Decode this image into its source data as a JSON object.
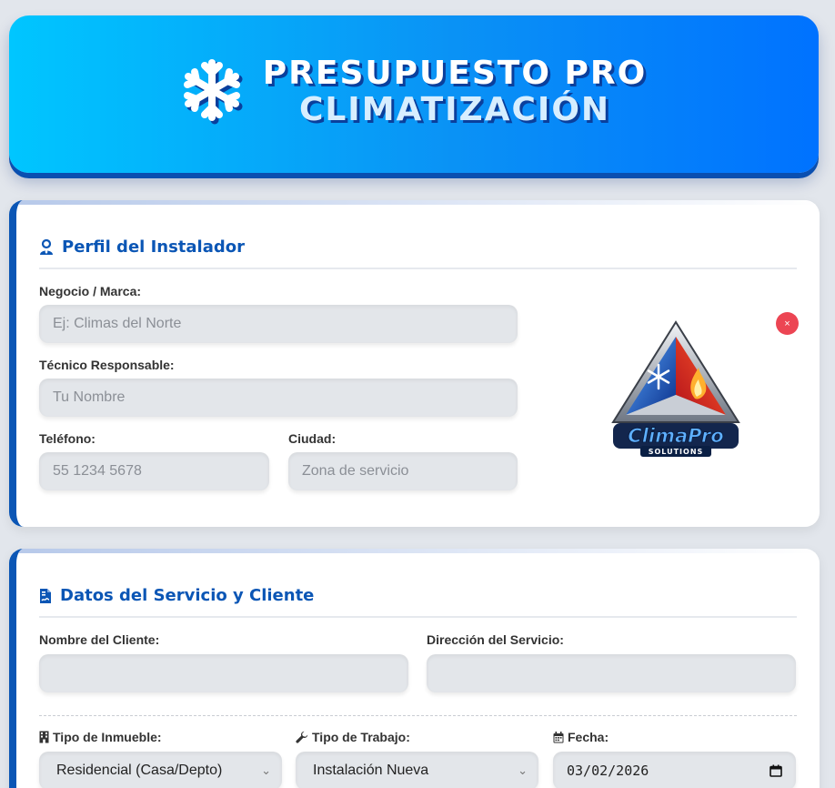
{
  "header": {
    "title_line1": "PRESUPUESTO PRO",
    "title_line2": "CLIMATIZACIÓN",
    "icon": "snowflake-icon"
  },
  "installer_profile": {
    "title": "Perfil del Instalador",
    "icon": "user-tie-icon",
    "business_label": "Negocio / Marca:",
    "business_placeholder": "Ej: Climas del Norte",
    "technician_label": "Técnico Responsable:",
    "technician_placeholder": "Tu Nombre",
    "phone_label": "Teléfono:",
    "phone_placeholder": "55 1234 5678",
    "city_label": "Ciudad:",
    "city_placeholder": "Zona de servicio",
    "remove_logo_label": "×",
    "logo": {
      "brand_text": "ClimaPro",
      "tagline": "SOLUTIONS"
    }
  },
  "service_client": {
    "title": "Datos del Servicio y Cliente",
    "icon": "file-contract-icon",
    "client_name_label": "Nombre del Cliente:",
    "client_name_value": "",
    "address_label": "Dirección del Servicio:",
    "address_value": "",
    "property_type_label": "Tipo de Inmueble:",
    "property_type_value": "Residencial (Casa/Depto)",
    "work_type_label": "Tipo de Trabajo:",
    "work_type_value": "Instalación Nueva",
    "date_label": "Fecha:",
    "date_value": "03/02/2026"
  },
  "colors": {
    "accent": "#0b56b5",
    "header_start": "#00c6ff",
    "header_end": "#0072ff",
    "danger": "#ec4553"
  }
}
